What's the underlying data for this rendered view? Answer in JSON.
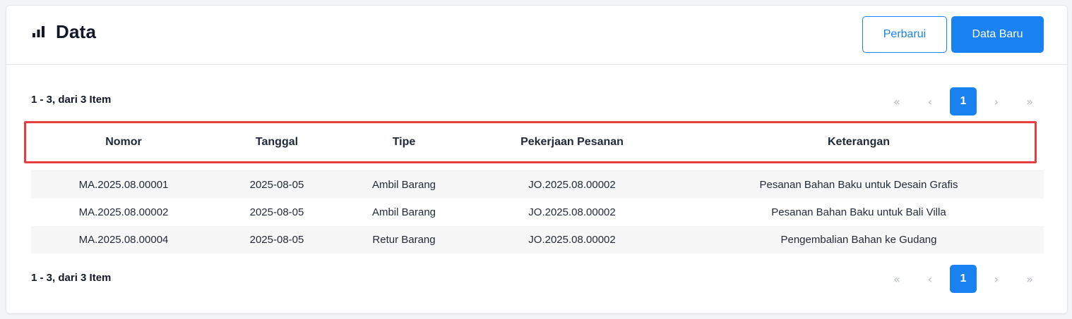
{
  "header": {
    "title": "Data",
    "icon": "bar-chart-icon",
    "refresh_label": "Perbarui",
    "new_label": "Data Baru"
  },
  "summary": {
    "top": "1 - 3, dari 3 Item",
    "bottom": "1 - 3, dari 3 Item"
  },
  "pagination": {
    "first": "«",
    "prev": "‹",
    "current": "1",
    "next": "›",
    "last": "»"
  },
  "table": {
    "columns": [
      "Nomor",
      "Tanggal",
      "Tipe",
      "Pekerjaan Pesanan",
      "Keterangan"
    ],
    "rows": [
      [
        "MA.2025.08.00001",
        "2025-08-05",
        "Ambil Barang",
        "JO.2025.08.00002",
        "Pesanan Bahan Baku untuk Desain Grafis"
      ],
      [
        "MA.2025.08.00002",
        "2025-08-05",
        "Ambil Barang",
        "JO.2025.08.00002",
        "Pesanan Bahan Baku untuk Bali Villa"
      ],
      [
        "MA.2025.08.00004",
        "2025-08-05",
        "Retur Barang",
        "JO.2025.08.00002",
        "Pengembalian Bahan ke Gudang"
      ]
    ]
  },
  "colors": {
    "primary": "#1a82f0",
    "highlight_border": "#e53e3e",
    "text": "#1f2937",
    "disabled_pager": "#b3b9c2"
  }
}
